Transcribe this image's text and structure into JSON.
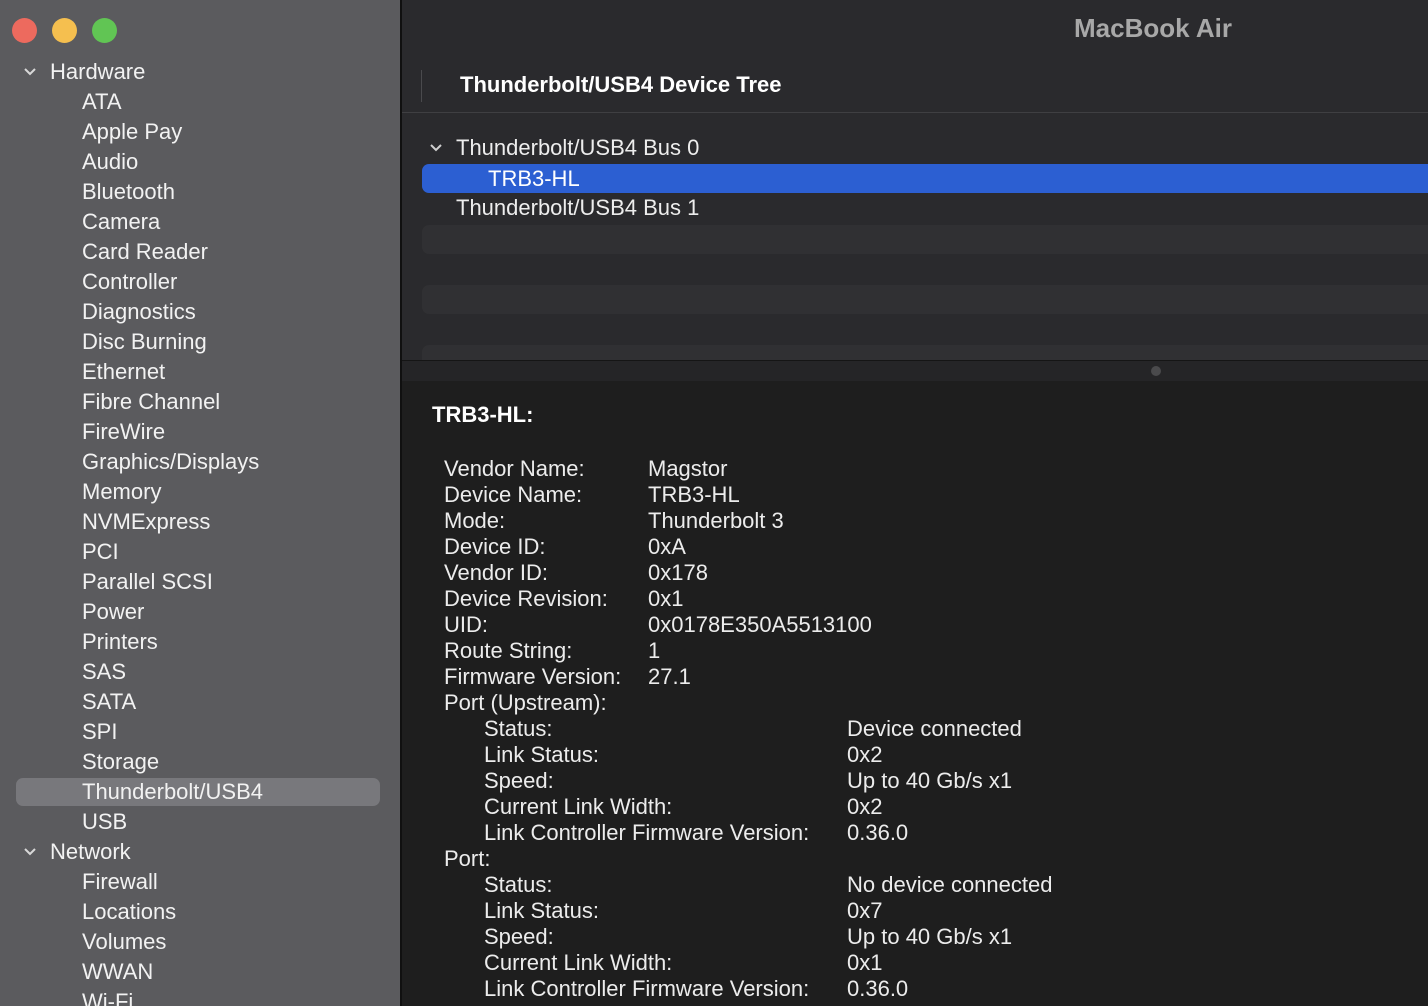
{
  "window": {
    "title": "MacBook Air"
  },
  "sidebar": {
    "hardware_label": "Hardware",
    "hardware_items": [
      "ATA",
      "Apple Pay",
      "Audio",
      "Bluetooth",
      "Camera",
      "Card Reader",
      "Controller",
      "Diagnostics",
      "Disc Burning",
      "Ethernet",
      "Fibre Channel",
      "FireWire",
      "Graphics/Displays",
      "Memory",
      "NVMExpress",
      "PCI",
      "Parallel SCSI",
      "Power",
      "Printers",
      "SAS",
      "SATA",
      "SPI",
      "Storage",
      "Thunderbolt/USB4",
      "USB"
    ],
    "selected_item": "Thunderbolt/USB4",
    "network_label": "Network",
    "network_items": [
      "Firewall",
      "Locations",
      "Volumes",
      "WWAN",
      "Wi-Fi"
    ]
  },
  "device_tree": {
    "header": "Thunderbolt/USB4 Device Tree",
    "bus0": "Thunderbolt/USB4 Bus 0",
    "selected_device": "TRB3-HL",
    "bus1": "Thunderbolt/USB4 Bus 1"
  },
  "detail": {
    "title": "TRB3-HL:",
    "properties": [
      {
        "label": "Vendor Name:",
        "value": "Magstor"
      },
      {
        "label": "Device Name:",
        "value": "TRB3-HL"
      },
      {
        "label": "Mode:",
        "value": "Thunderbolt 3"
      },
      {
        "label": "Device ID:",
        "value": "0xA"
      },
      {
        "label": "Vendor ID:",
        "value": "0x178"
      },
      {
        "label": "Device Revision:",
        "value": "0x1"
      },
      {
        "label": "UID:",
        "value": "0x0178E350A5513100"
      },
      {
        "label": "Route String:",
        "value": "1"
      },
      {
        "label": "Firmware Version:",
        "value": "27.1"
      }
    ],
    "port_upstream": {
      "label": "Port (Upstream):",
      "properties": [
        {
          "label": "Status:",
          "value": "Device connected"
        },
        {
          "label": "Link Status:",
          "value": "0x2"
        },
        {
          "label": "Speed:",
          "value": "Up to 40 Gb/s x1"
        },
        {
          "label": "Current Link Width:",
          "value": "0x2"
        },
        {
          "label": "Link Controller Firmware Version:",
          "value": "0.36.0"
        }
      ]
    },
    "port": {
      "label": "Port:",
      "properties": [
        {
          "label": "Status:",
          "value": "No device connected"
        },
        {
          "label": "Link Status:",
          "value": "0x7"
        },
        {
          "label": "Speed:",
          "value": "Up to 40 Gb/s x1"
        },
        {
          "label": "Current Link Width:",
          "value": "0x1"
        },
        {
          "label": "Link Controller Firmware Version:",
          "value": "0.36.0"
        }
      ]
    }
  },
  "colors": {
    "sidebar_bg": "#5b5b5e",
    "sidebar_selected": "#78787c",
    "selection_blue": "#2c5fd2",
    "close": "#ed6a5e",
    "minimize": "#f5bf4f",
    "zoom": "#61c554"
  }
}
